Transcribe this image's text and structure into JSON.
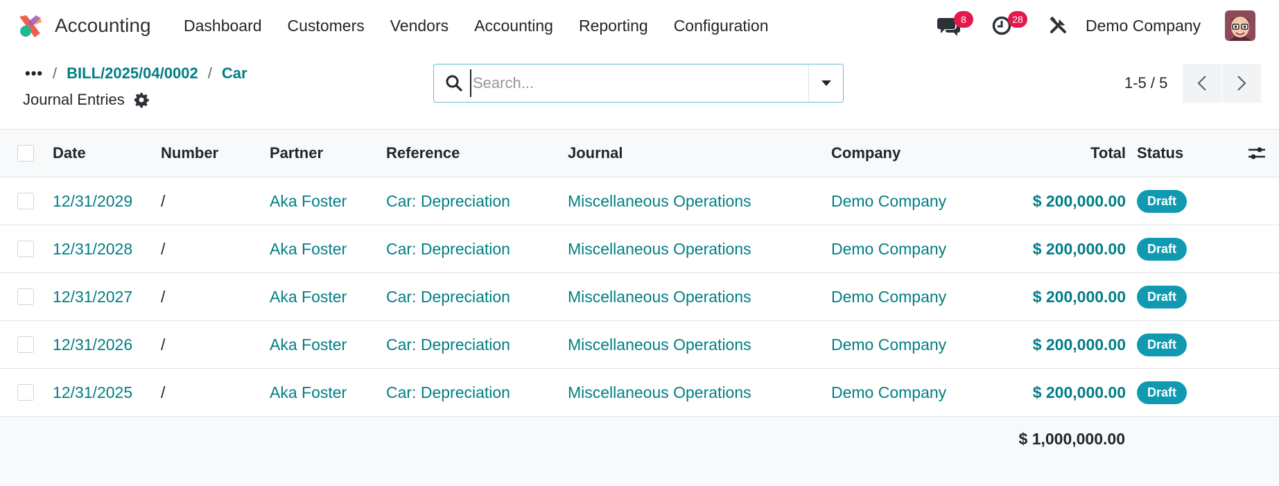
{
  "app": {
    "name": "Accounting",
    "menu": [
      "Dashboard",
      "Customers",
      "Vendors",
      "Accounting",
      "Reporting",
      "Configuration"
    ],
    "messages_count": "8",
    "activities_count": "28",
    "company": "Demo Company"
  },
  "breadcrumb": {
    "more": "•••",
    "sep": "/",
    "items": [
      "BILL/2025/04/0002",
      "Car"
    ],
    "current": "Journal Entries"
  },
  "search": {
    "placeholder": "Search..."
  },
  "pager": {
    "value": "1-5 / 5"
  },
  "table": {
    "columns": {
      "date": "Date",
      "number": "Number",
      "partner": "Partner",
      "reference": "Reference",
      "journal": "Journal",
      "company": "Company",
      "total": "Total",
      "status": "Status"
    },
    "rows": [
      {
        "date": "12/31/2029",
        "number": "/",
        "partner": "Aka Foster",
        "reference": "Car: Depreciation",
        "journal": "Miscellaneous Operations",
        "company": "Demo Company",
        "total": "$ 200,000.00",
        "status": "Draft"
      },
      {
        "date": "12/31/2028",
        "number": "/",
        "partner": "Aka Foster",
        "reference": "Car: Depreciation",
        "journal": "Miscellaneous Operations",
        "company": "Demo Company",
        "total": "$ 200,000.00",
        "status": "Draft"
      },
      {
        "date": "12/31/2027",
        "number": "/",
        "partner": "Aka Foster",
        "reference": "Car: Depreciation",
        "journal": "Miscellaneous Operations",
        "company": "Demo Company",
        "total": "$ 200,000.00",
        "status": "Draft"
      },
      {
        "date": "12/31/2026",
        "number": "/",
        "partner": "Aka Foster",
        "reference": "Car: Depreciation",
        "journal": "Miscellaneous Operations",
        "company": "Demo Company",
        "total": "$ 200,000.00",
        "status": "Draft"
      },
      {
        "date": "12/31/2025",
        "number": "/",
        "partner": "Aka Foster",
        "reference": "Car: Depreciation",
        "journal": "Miscellaneous Operations",
        "company": "Demo Company",
        "total": "$ 200,000.00",
        "status": "Draft"
      }
    ],
    "grand_total": "$ 1,000,000.00"
  },
  "colors": {
    "link": "#017e84",
    "badge": "#e21a4b",
    "status_draft": "#0f9ab1"
  },
  "icons": [
    "app-logo-icon",
    "chat-icon",
    "clock-icon",
    "tools-icon",
    "gear-icon",
    "search-icon",
    "caret-down-icon",
    "chevron-left-icon",
    "chevron-right-icon",
    "column-settings-icon"
  ]
}
